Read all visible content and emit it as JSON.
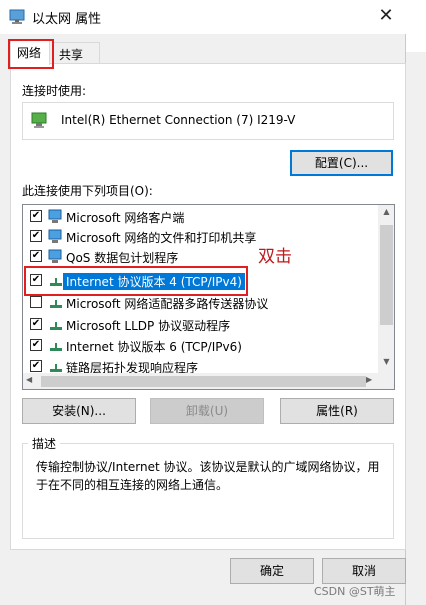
{
  "window": {
    "title": "以太网 属性",
    "close_label": "✕"
  },
  "tabs": [
    {
      "label": "网络",
      "active": true
    },
    {
      "label": "共享",
      "active": false
    }
  ],
  "connect_using": {
    "label": "连接时使用:",
    "adapter": "Intel(R) Ethernet Connection (7) I219-V",
    "config_button": "配置(C)..."
  },
  "items_section": {
    "label": "此连接使用下列项目(O):",
    "items": [
      {
        "label": "Microsoft 网络客户端",
        "checked": true,
        "icon": "network-client-icon"
      },
      {
        "label": "Microsoft 网络的文件和打印机共享",
        "checked": true,
        "icon": "network-share-icon"
      },
      {
        "label": "QoS 数据包计划程序",
        "checked": true,
        "icon": "network-service-icon"
      },
      {
        "label": "Internet 协议版本 4 (TCP/IPv4)",
        "checked": true,
        "selected": true,
        "icon": "protocol-icon"
      },
      {
        "label": "Microsoft 网络适配器多路传送器协议",
        "checked": false,
        "icon": "protocol-icon"
      },
      {
        "label": "Microsoft LLDP 协议驱动程序",
        "checked": true,
        "icon": "protocol-icon"
      },
      {
        "label": "Internet 协议版本 6 (TCP/IPv6)",
        "checked": true,
        "icon": "protocol-icon"
      },
      {
        "label": "链路层拓扑发现响应程序",
        "checked": true,
        "icon": "protocol-icon"
      }
    ]
  },
  "annotation": "双击",
  "buttons": {
    "install": "安装(N)...",
    "uninstall": "卸载(U)",
    "properties": "属性(R)",
    "ok": "确定",
    "cancel": "取消"
  },
  "description": {
    "legend": "描述",
    "text": "传输控制协议/Internet 协议。该协议是默认的广域网络协议，用于在不同的相互连接的网络上通信。"
  },
  "watermark": "CSDN @ST萌主",
  "colors": {
    "selection": "#0078d7",
    "highlight_box": "#e02020",
    "annotation": "#c0181c"
  }
}
